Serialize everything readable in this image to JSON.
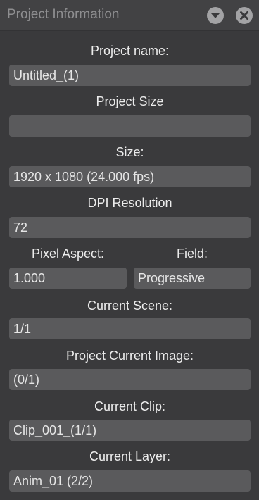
{
  "panel": {
    "title": "Project Information",
    "icons": {
      "menu": "chevron-down-circle-icon",
      "close": "close-circle-icon"
    }
  },
  "fields": {
    "project_name": {
      "label": "Project name:",
      "value": "Untitled_(1)"
    },
    "project_size": {
      "label": "Project Size",
      "value": ""
    },
    "size": {
      "label": "Size:",
      "value": "1920 x 1080 (24.000 fps)"
    },
    "dpi_resolution": {
      "label": "DPI Resolution",
      "value": "72"
    },
    "pixel_aspect": {
      "label": "Pixel Aspect:",
      "value": "1.000"
    },
    "field": {
      "label": "Field:",
      "value": "Progressive"
    },
    "current_scene": {
      "label": "Current Scene:",
      "value": "1/1"
    },
    "project_current_image": {
      "label": "Project Current Image:",
      "value": "(0/1)"
    },
    "current_clip": {
      "label": "Current Clip:",
      "value": "Clip_001_(1/1)"
    },
    "current_layer": {
      "label": "Current Layer:",
      "value": "Anim_01 (2/2)"
    }
  },
  "colors": {
    "background": "#3a3a3c",
    "titlebar": "#424244",
    "field_background": "#5a5a5c",
    "label_text": "#ececec",
    "title_text": "#8e8e90"
  }
}
